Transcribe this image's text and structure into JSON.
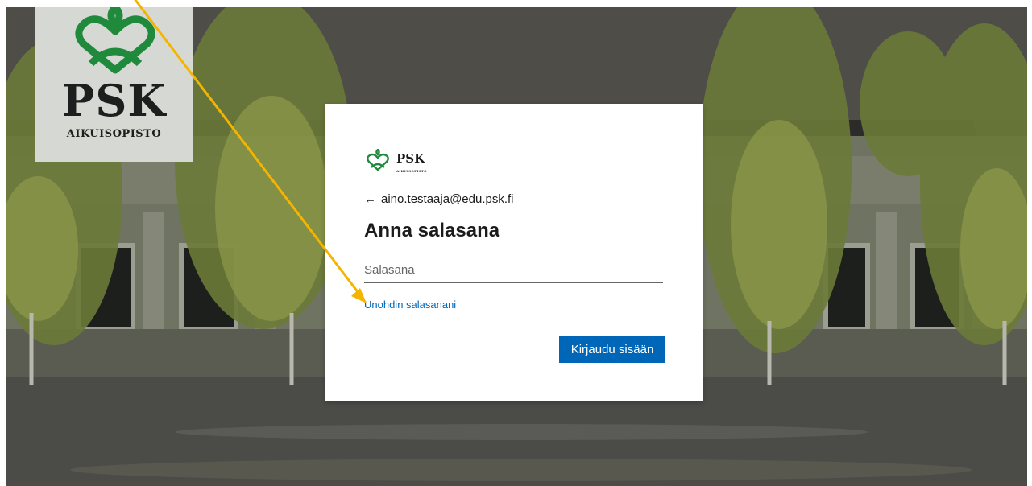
{
  "background_logo": {
    "brand": "PSK",
    "subtitle": "AIKUISOPISTO",
    "color": "#1f8a3c"
  },
  "login": {
    "logo_text": "PSK",
    "logo_subtext": "AIKUISOPISTO",
    "back_arrow": "←",
    "account": "aino.testaaja@edu.psk.fi",
    "title": "Anna salasana",
    "password_placeholder": "Salasana",
    "forgot_link": "Unohdin salasanani",
    "submit_label": "Kirjaudu sisään",
    "accent_color": "#0067b8"
  },
  "annotation": {
    "color": "#f5b400",
    "icon": "arrow-annotation"
  }
}
